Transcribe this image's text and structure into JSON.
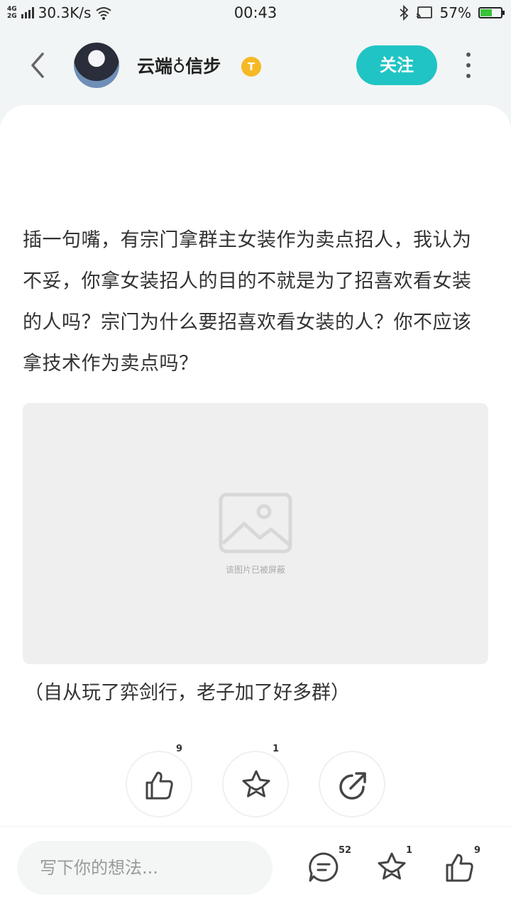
{
  "status_bar": {
    "net_top": "4G",
    "net_bottom": "2G",
    "speed": "30.3K/s",
    "time": "00:43",
    "battery": "57%",
    "battery_level": 0.57,
    "battery_color": "#3cc13c"
  },
  "header": {
    "username": "云端♁信步",
    "badge": "T",
    "follow_label": "关注",
    "accent": "#21c4c4"
  },
  "post": {
    "text": "插一句嘴，有宗门拿群主女装作为卖点招人，我认为不妥，你拿女装招人的目的不就是为了招喜欢看女装的人吗？宗门为什么要招喜欢看女装的人？你不应该拿技术作为卖点吗？",
    "image_blocked_text": "该图片已被屏蔽",
    "caption": "（自从玩了弈剑行，老子加了好多群）"
  },
  "actions": {
    "like_count": "9",
    "favorite_count": "1"
  },
  "bottom_bar": {
    "input_placeholder": "写下你的想法...",
    "comment_count": "52",
    "favorite_count": "1",
    "like_count": "9"
  },
  "icons": {
    "back": "chevron-left-icon",
    "more": "more-vertical-icon",
    "like": "thumbs-up-icon",
    "favorite": "star-icon",
    "share": "share-icon",
    "comment": "comment-icon",
    "image_placeholder": "image-icon"
  }
}
